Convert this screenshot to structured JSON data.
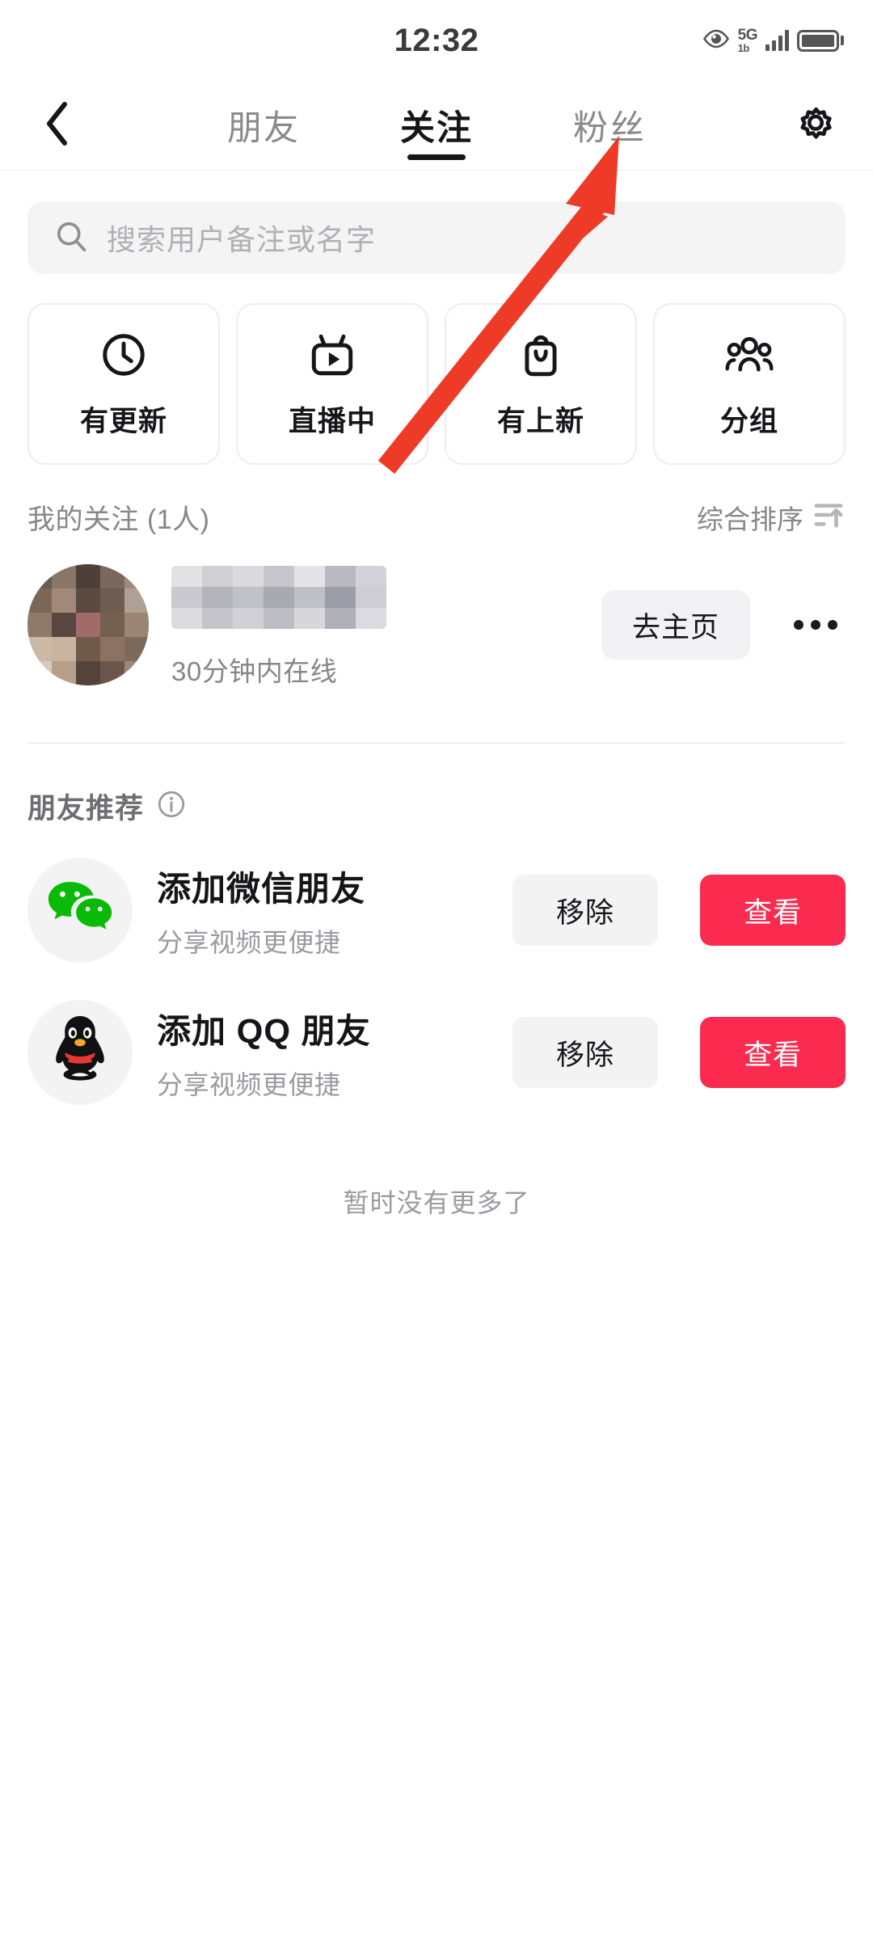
{
  "status_bar": {
    "time": "12:32",
    "network_label": "5G",
    "network_sub": "1b",
    "eye_icon": "eye-icon",
    "signal_icon": "signal-bars-icon",
    "battery_icon": "battery-icon"
  },
  "navbar": {
    "back_icon": "chevron-left-icon",
    "settings_icon": "gear-icon",
    "tabs": [
      {
        "label": "朋友",
        "active": false
      },
      {
        "label": "关注",
        "active": true
      },
      {
        "label": "粉丝",
        "active": false
      }
    ]
  },
  "search": {
    "placeholder": "搜索用户备注或名字",
    "icon": "search-icon",
    "value": ""
  },
  "quick_cards": [
    {
      "label": "有更新",
      "icon": "clock-icon"
    },
    {
      "label": "直播中",
      "icon": "live-tv-icon"
    },
    {
      "label": "有上新",
      "icon": "shopping-bag-icon"
    },
    {
      "label": "分组",
      "icon": "people-group-icon"
    }
  ],
  "following_section": {
    "title": "我的关注 (1人)",
    "sort_label": "综合排序",
    "sort_icon": "sort-filter-icon",
    "user": {
      "avatar": "blurred-user-avatar",
      "name_redacted": true,
      "status": "30分钟内在线",
      "action_label": "去主页",
      "more_icon": "more-dots-icon"
    }
  },
  "recommend_section": {
    "title": "朋友推荐",
    "info_icon": "info-circle-icon",
    "items": [
      {
        "icon": "wechat-icon",
        "name": "添加微信朋友",
        "desc": "分享视频更便捷",
        "dismiss_label": "移除",
        "action_label": "查看"
      },
      {
        "icon": "qq-penguin-icon",
        "name": "添加 QQ 朋友",
        "desc": "分享视频更便捷",
        "dismiss_label": "移除",
        "action_label": "查看"
      }
    ]
  },
  "footer": {
    "text": "暂时没有更多了"
  },
  "annotation": {
    "type": "arrow",
    "color": "#EE3B28",
    "points_to": "粉丝"
  },
  "colors": {
    "accent_red": "#FA2B4E",
    "annotation_red": "#EE3B28",
    "text_primary": "#16161A",
    "text_secondary": "#86868B",
    "surface_gray": "#F3F3F4",
    "wechat_green": "#09BB07"
  }
}
